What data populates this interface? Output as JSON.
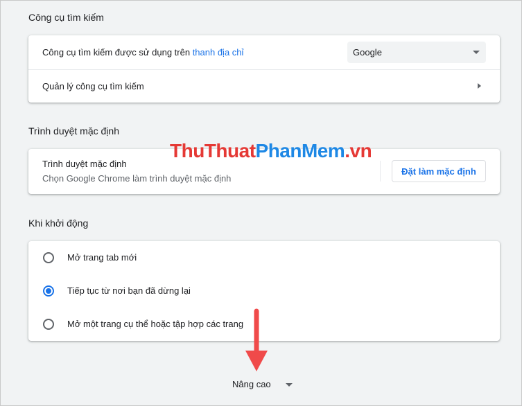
{
  "search_engine": {
    "title": "Công cụ tìm kiếm",
    "row1_label": "Công cụ tìm kiếm được sử dụng trên ",
    "row1_link": "thanh địa chỉ",
    "selected_engine": "Google",
    "row2_label": "Quản lý công cụ tìm kiếm"
  },
  "default_browser": {
    "title": "Trình duyệt mặc định",
    "label": "Trình duyệt mặc định",
    "sublabel": "Chọn Google Chrome làm trình duyệt mặc định",
    "button_label": "Đặt làm mặc định"
  },
  "on_startup": {
    "title": "Khi khởi động",
    "options": [
      {
        "label": "Mở trang tab mới",
        "selected": false
      },
      {
        "label": "Tiếp tục từ nơi bạn đã dừng lại",
        "selected": true
      },
      {
        "label": "Mở một trang cụ thể hoặc tập hợp các trang",
        "selected": false
      }
    ]
  },
  "advanced_label": "Nâng cao",
  "watermark": {
    "part1": "ThuThuat",
    "part2": "PhanMem",
    "part3": ".vn"
  },
  "colors": {
    "accent": "#1a73e8",
    "annotation_arrow": "#f04a4a"
  }
}
